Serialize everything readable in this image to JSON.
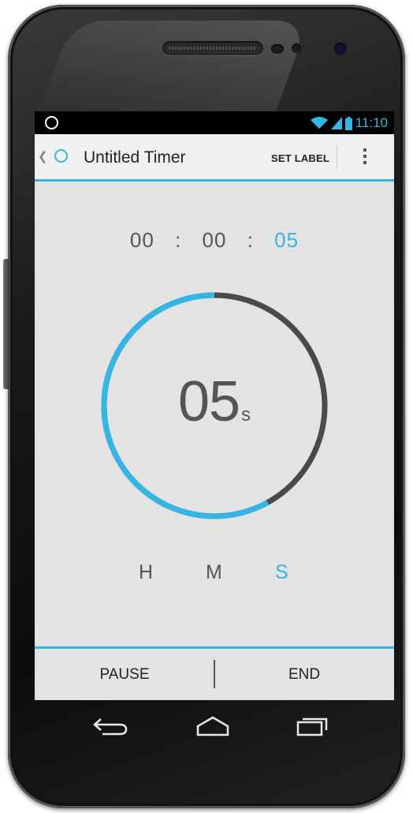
{
  "status_bar": {
    "time": "11:10",
    "icons": [
      "notification-icon",
      "wifi-icon",
      "signal-icon",
      "battery-icon"
    ]
  },
  "action_bar": {
    "title": "Untitled Timer",
    "set_label": "SET LABEL",
    "up_icon": "chevron-left-icon",
    "app_icon": "timer-circle-icon",
    "overflow_icon": "overflow-menu-icon"
  },
  "digital_time": {
    "hours": "00",
    "minutes": "00",
    "seconds": "05",
    "separator": ":"
  },
  "dial": {
    "value": "05",
    "unit": "s",
    "progress": 0.58
  },
  "units": {
    "hours": "H",
    "minutes": "M",
    "seconds": "S",
    "selected": "S"
  },
  "bottom_bar": {
    "pause_label": "PAUSE",
    "end_label": "END"
  },
  "nav_bar": {
    "icons": [
      "back-icon",
      "home-icon",
      "recents-icon"
    ]
  },
  "colors": {
    "accent": "#33b5e5",
    "screen_bg": "#e3e3e3",
    "text": "#555555",
    "track": "#4a4a4a"
  }
}
